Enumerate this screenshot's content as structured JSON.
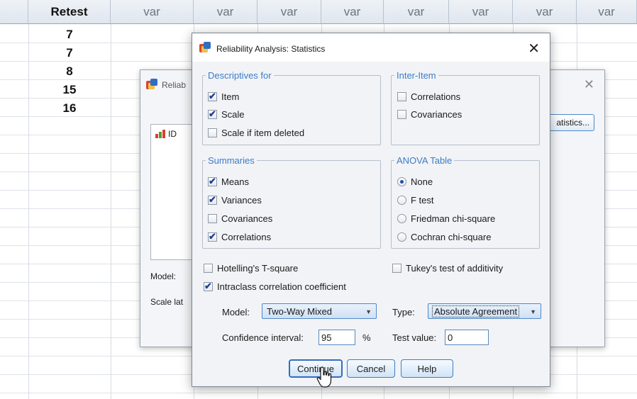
{
  "spreadsheet": {
    "columns": [
      "Retest",
      "var",
      "var",
      "var",
      "var",
      "var",
      "var",
      "var",
      "var"
    ],
    "retest_values": [
      "7",
      "7",
      "8",
      "15",
      "16"
    ]
  },
  "background_dialog": {
    "title": "Reliab",
    "list_item": "ID",
    "statistics_button": "atistics...",
    "model_label": "Model:",
    "scale_label": "Scale lat"
  },
  "dialog": {
    "title": "Reliability Analysis: Statistics",
    "close_icon": "close-icon",
    "descriptives": {
      "legend": "Descriptives for",
      "item": {
        "label": "Item",
        "checked": true
      },
      "scale": {
        "label": "Scale",
        "checked": true
      },
      "scale_if_deleted": {
        "label": "Scale if item deleted",
        "checked": false
      }
    },
    "inter_item": {
      "legend": "Inter-Item",
      "correlations": {
        "label": "Correlations",
        "checked": false
      },
      "covariances": {
        "label": "Covariances",
        "checked": false
      }
    },
    "summaries": {
      "legend": "Summaries",
      "means": {
        "label": "Means",
        "checked": true
      },
      "variances": {
        "label": "Variances",
        "checked": true
      },
      "covariances": {
        "label": "Covariances",
        "checked": false
      },
      "correlations": {
        "label": "Correlations",
        "checked": true
      }
    },
    "anova": {
      "legend": "ANOVA Table",
      "options": [
        "None",
        "F test",
        "Friedman chi-square",
        "Cochran chi-square"
      ],
      "selected": "None"
    },
    "hotelling": {
      "label": "Hotelling's T-square",
      "checked": false
    },
    "tukey": {
      "label": "Tukey's test of additivity",
      "checked": false
    },
    "intraclass": {
      "label": "Intraclass correlation coefficient",
      "checked": true
    },
    "model": {
      "label": "Model:",
      "value": "Two-Way Mixed"
    },
    "type": {
      "label": "Type:",
      "value": "Absolute Agreement"
    },
    "confidence": {
      "label": "Confidence interval:",
      "value": "95",
      "unit": "%"
    },
    "test_value": {
      "label": "Test value:",
      "value": "0"
    },
    "buttons": {
      "continue": "Continue",
      "cancel": "Cancel",
      "help": "Help"
    }
  },
  "colors": {
    "accent": "#3d7cc9",
    "button_border": "#3e7fc4",
    "check": "#1f3fa0"
  }
}
